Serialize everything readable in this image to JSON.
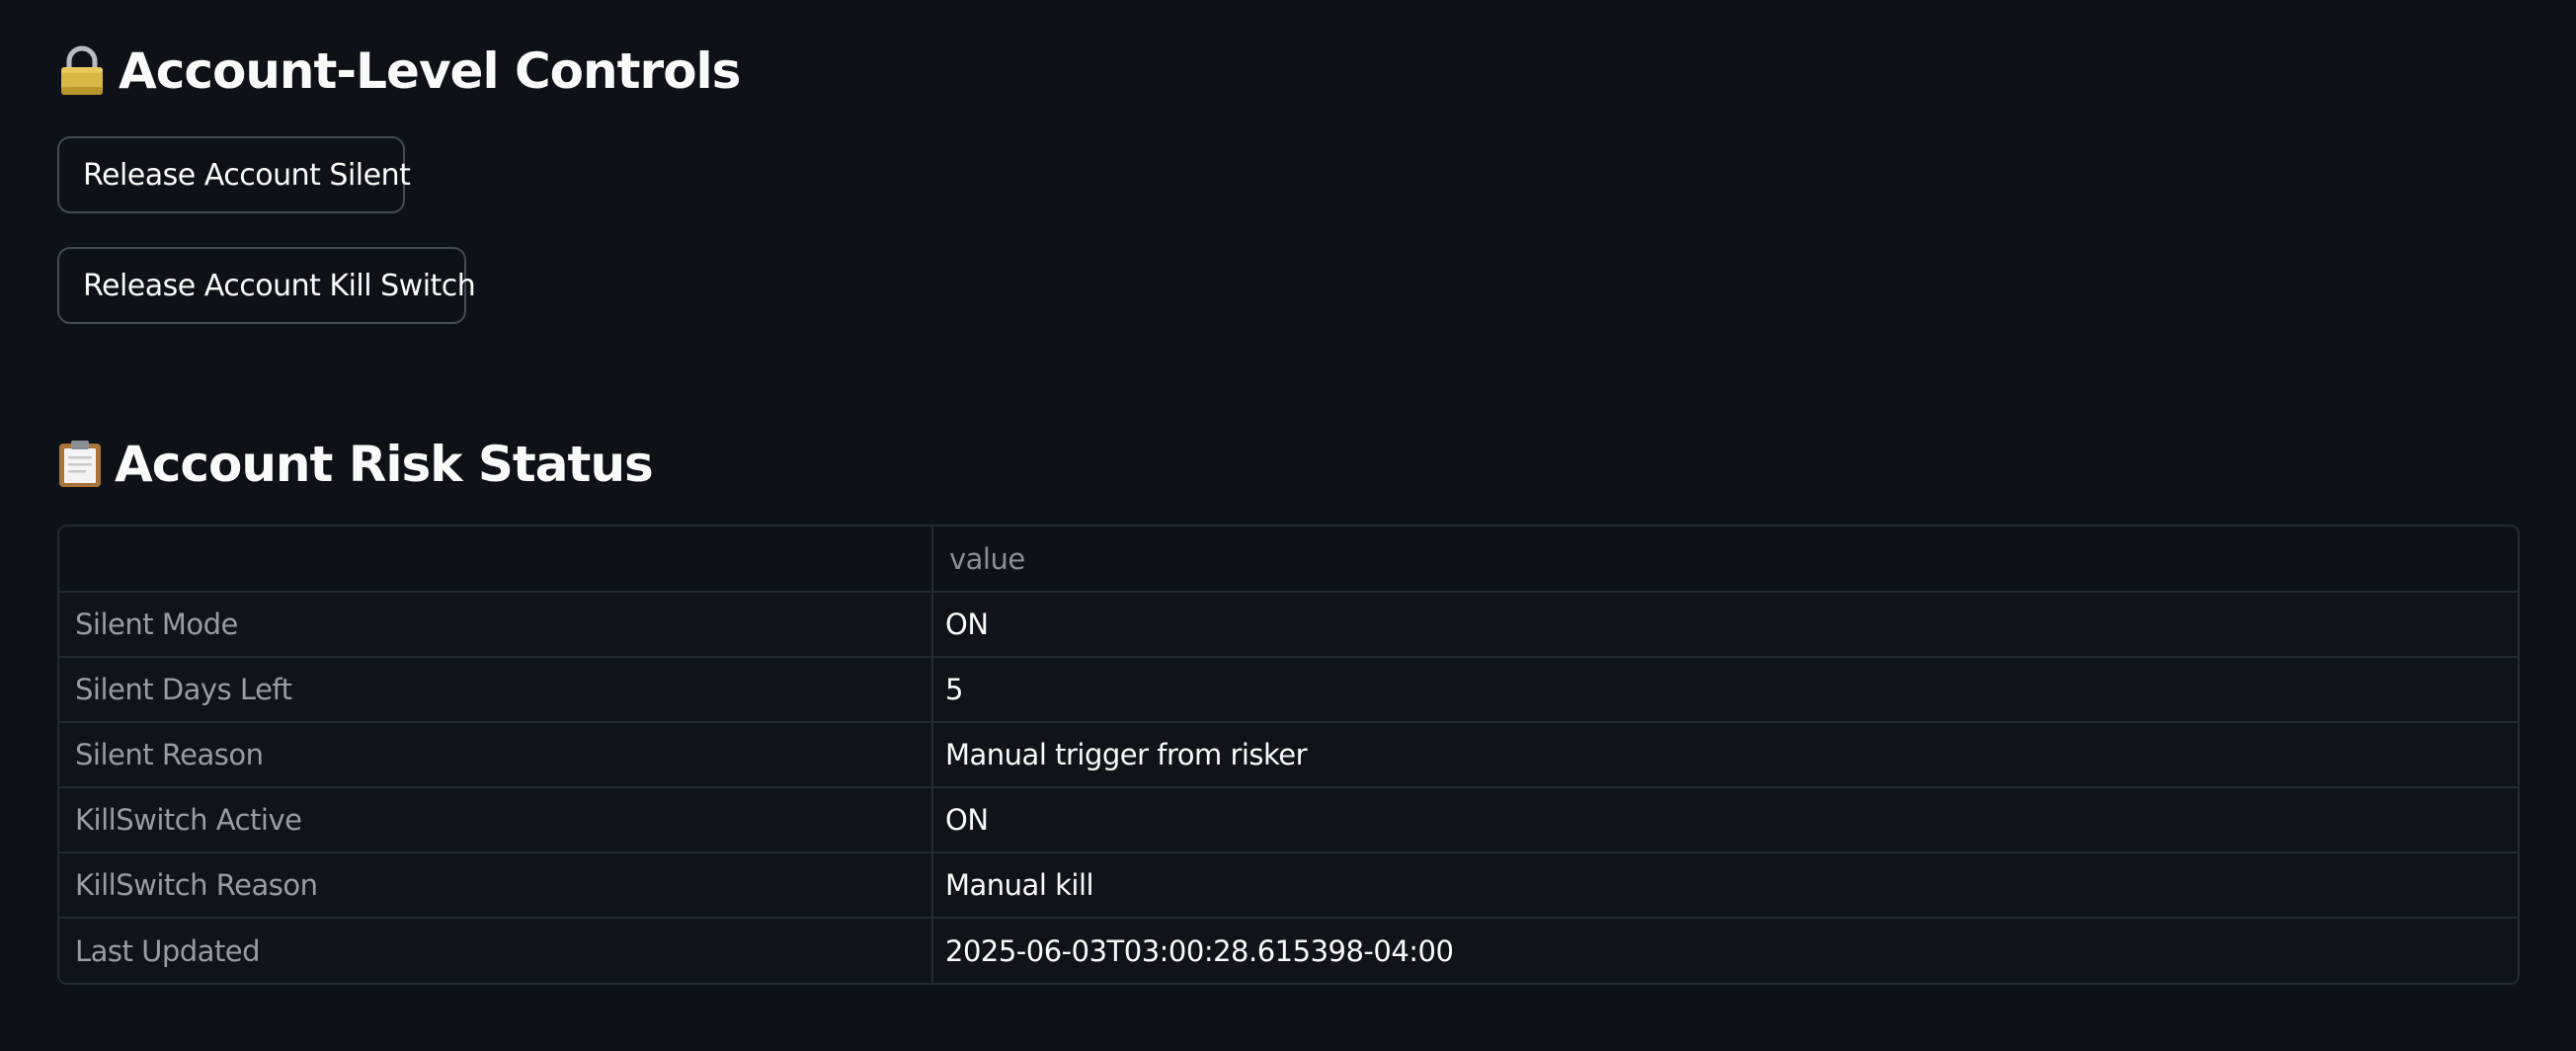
{
  "controls": {
    "title": "Account-Level Controls",
    "title_icon": "lock-icon",
    "buttons": {
      "release_silent": "Release Account Silent",
      "release_kill_switch": "Release Account Kill Switch"
    }
  },
  "status": {
    "title": "Account Risk Status",
    "title_icon": "clipboard-icon",
    "table": {
      "index_header": "",
      "value_header": "value",
      "rows": [
        {
          "label": "Silent Mode",
          "value": "ON"
        },
        {
          "label": "Silent Days Left",
          "value": "5"
        },
        {
          "label": "Silent Reason",
          "value": "Manual trigger from risker"
        },
        {
          "label": "KillSwitch Active",
          "value": "ON"
        },
        {
          "label": "KillSwitch Reason",
          "value": "Manual kill"
        },
        {
          "label": "Last Updated",
          "value": "2025-06-03T03:00:28.615398-04:00"
        }
      ]
    }
  },
  "colors": {
    "background": "#0e1117",
    "text": "#fafafa",
    "muted_text": "#9a9ca3",
    "border": "#262a33",
    "button_border": "#464a55"
  }
}
